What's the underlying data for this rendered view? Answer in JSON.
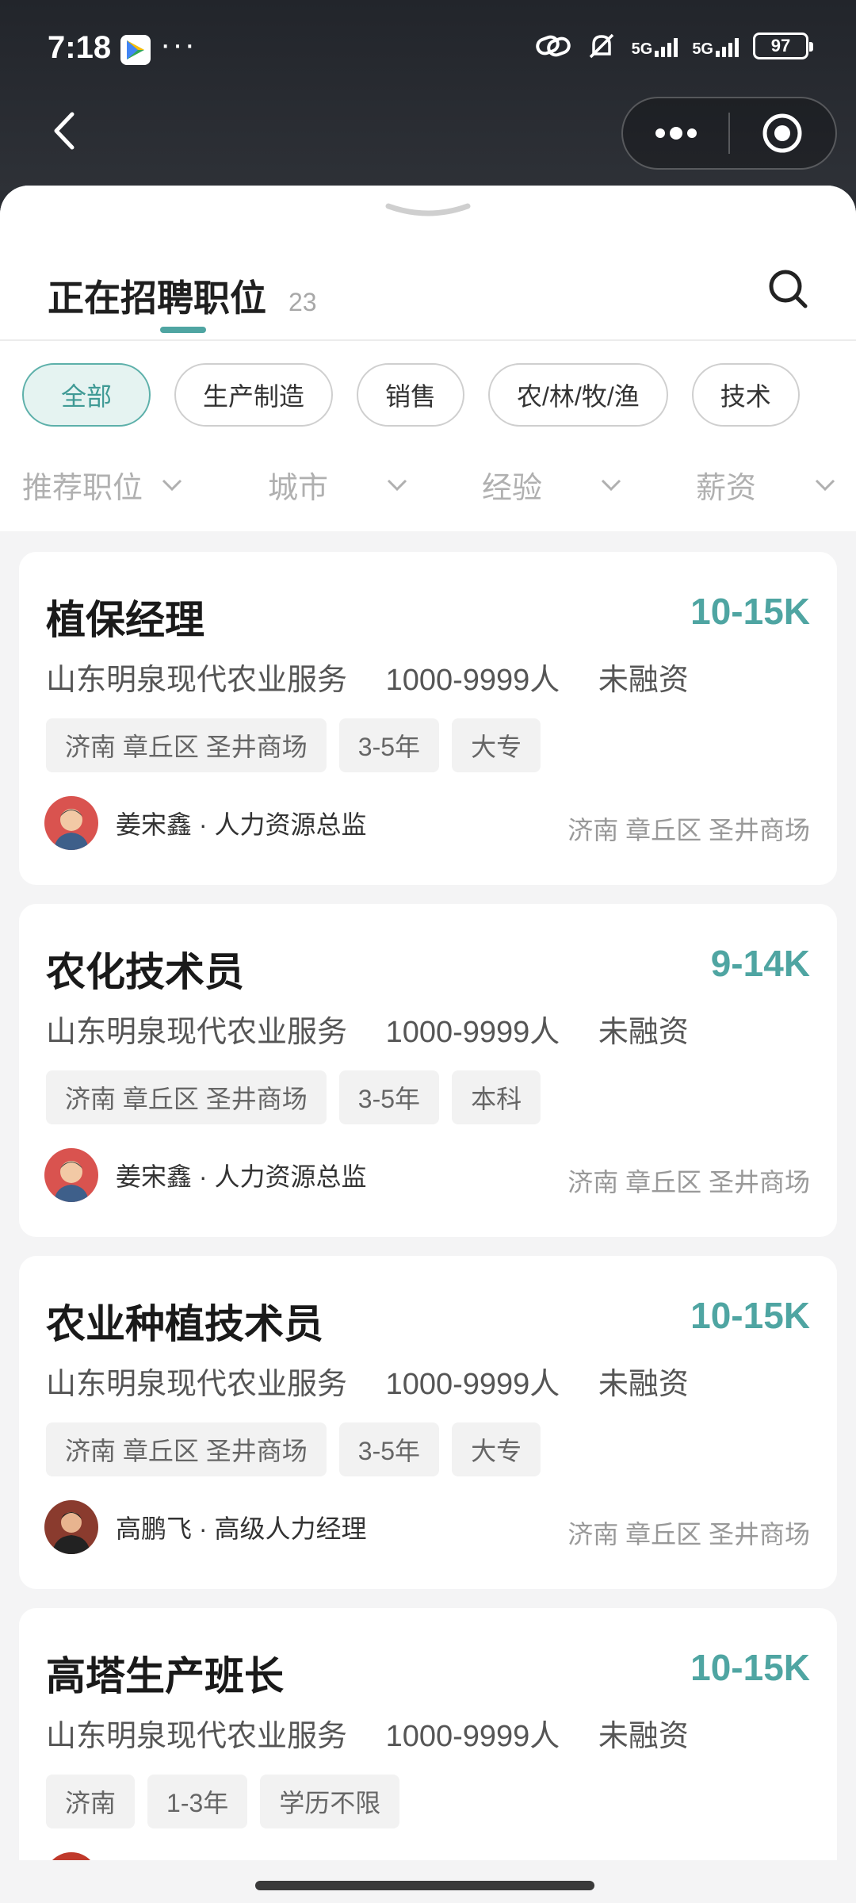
{
  "status": {
    "time": "7:18",
    "dots": "···",
    "net1": "5G",
    "net2": "5G",
    "battery": "97"
  },
  "header": {
    "title": "正在招聘职位",
    "count": "23"
  },
  "categories": [
    "全部",
    "生产制造",
    "销售",
    "农/林/牧/渔",
    "技术"
  ],
  "filters": [
    "推荐职位",
    "城市",
    "经验",
    "薪资"
  ],
  "jobs": [
    {
      "title": "植保经理",
      "salary": "10-15K",
      "company": "山东明泉现代农业服务",
      "size": "1000-9999人",
      "funding": "未融资",
      "tags": [
        "济南 章丘区 圣井商场",
        "3-5年",
        "大专"
      ],
      "recruiter": "姜宋鑫 · 人力资源总监",
      "location": "济南 章丘区 圣井商场"
    },
    {
      "title": "农化技术员",
      "salary": "9-14K",
      "company": "山东明泉现代农业服务",
      "size": "1000-9999人",
      "funding": "未融资",
      "tags": [
        "济南 章丘区 圣井商场",
        "3-5年",
        "本科"
      ],
      "recruiter": "姜宋鑫 · 人力资源总监",
      "location": "济南 章丘区 圣井商场"
    },
    {
      "title": "农业种植技术员",
      "salary": "10-15K",
      "company": "山东明泉现代农业服务",
      "size": "1000-9999人",
      "funding": "未融资",
      "tags": [
        "济南 章丘区 圣井商场",
        "3-5年",
        "大专"
      ],
      "recruiter": "高鹏飞 · 高级人力经理",
      "location": "济南 章丘区 圣井商场"
    },
    {
      "title": "高塔生产班长",
      "salary": "10-15K",
      "company": "山东明泉现代农业服务",
      "size": "1000-9999人",
      "funding": "未融资",
      "tags": [
        "济南",
        "1-3年",
        "学历不限"
      ],
      "recruiter": "",
      "location": ""
    }
  ],
  "colors": {
    "accent": "#4fa5a2",
    "chip_active_bg": "#e5f3f1",
    "top_bg": "#2a2d33"
  },
  "icons": [
    "back-arrow-icon",
    "more-dots-icon",
    "target-icon",
    "search-icon",
    "chevron-down-icon"
  ]
}
